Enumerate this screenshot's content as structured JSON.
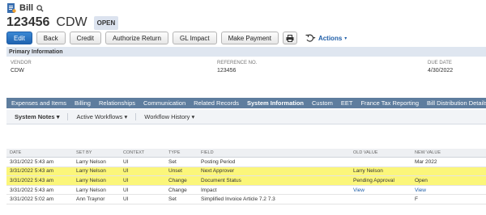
{
  "header": {
    "record_type": "Bill",
    "search_icon": "search-icon",
    "record_number": "123456",
    "vendor_short": "CDW",
    "status": "OPEN"
  },
  "toolbar": {
    "edit": "Edit",
    "back": "Back",
    "credit": "Credit",
    "authorize_return": "Authorize Return",
    "gl_impact": "GL Impact",
    "make_payment": "Make Payment",
    "actions": "Actions"
  },
  "primary_info": {
    "title": "Primary Information",
    "vendor_label": "VENDOR",
    "vendor_value": "CDW",
    "reference_label": "REFERENCE NO.",
    "reference_value": "123456",
    "due_label": "DUE DATE",
    "due_value": "4/30/2022"
  },
  "tabs": [
    {
      "label": "Expenses and Items"
    },
    {
      "label": "Billing"
    },
    {
      "label": "Relationships"
    },
    {
      "label": "Communication"
    },
    {
      "label": "Related Records"
    },
    {
      "label": "System Information",
      "active": true
    },
    {
      "label": "Custom"
    },
    {
      "label": "EET"
    },
    {
      "label": "France Tax Reporting"
    },
    {
      "label": "Bill Distribution Details"
    }
  ],
  "subtabs": {
    "system_notes": "System Notes",
    "active_workflows": "Active Workflows",
    "workflow_history": "Workflow History"
  },
  "table": {
    "columns": [
      "DATE",
      "SET BY",
      "CONTEXT",
      "TYPE",
      "FIELD",
      "OLD VALUE",
      "NEW VALUE"
    ],
    "rows": [
      {
        "date": "3/31/2022 5:43 am",
        "set_by": "Larry Nelson",
        "context": "UI",
        "type": "Set",
        "field": "Posting Period",
        "old": "",
        "new": "Mar 2022",
        "highlight": false
      },
      {
        "date": "3/31/2022 5:43 am",
        "set_by": "Larry Nelson",
        "context": "UI",
        "type": "Unset",
        "field": "Next Approver",
        "old": "Larry Nelson",
        "new": "",
        "highlight": true
      },
      {
        "date": "3/31/2022 5:43 am",
        "set_by": "Larry Nelson",
        "context": "UI",
        "type": "Change",
        "field": "Document Status",
        "old": "Pending Approval",
        "new": "Open",
        "highlight": true
      },
      {
        "date": "3/31/2022 5:43 am",
        "set_by": "Larry Nelson",
        "context": "UI",
        "type": "Change",
        "field": "Impact",
        "old": "View",
        "new": "View",
        "highlight": false
      },
      {
        "date": "3/31/2022 5:02 am",
        "set_by": "Ann Traynor",
        "context": "UI",
        "type": "Set",
        "field": "Simplified Invoice Article 7.2 7.3",
        "old": "",
        "new": "F",
        "highlight": false
      }
    ]
  },
  "colors": {
    "primary_button": "#1f63b0",
    "tab_bar": "#5e7d9e",
    "highlight": "#fbf67a",
    "section_header": "#dfe6f0"
  }
}
